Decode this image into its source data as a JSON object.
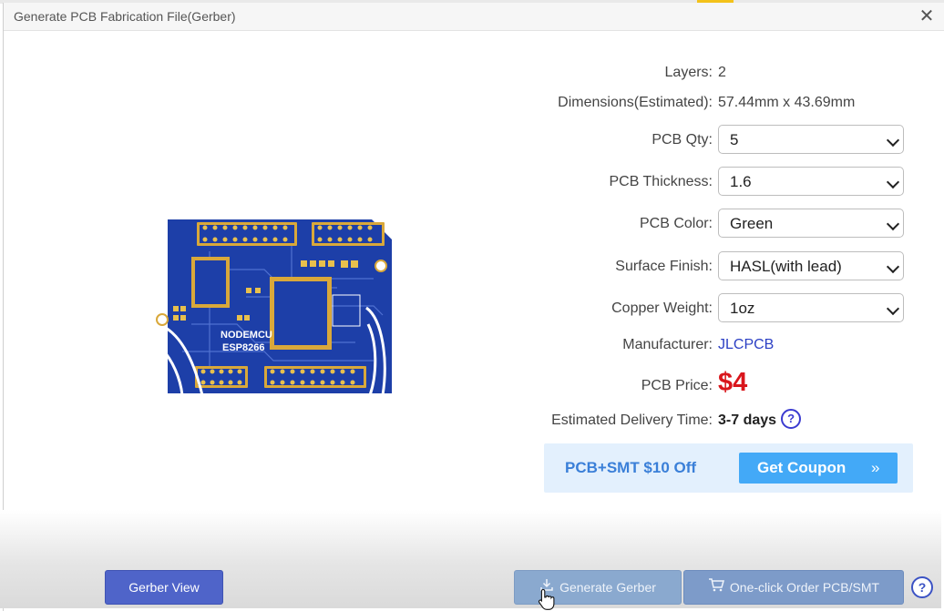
{
  "dialog": {
    "title": "Generate PCB Fabrication File(Gerber)",
    "close_icon": "close-icon"
  },
  "board": {
    "silkscreen_line1": "NODEMCU",
    "silkscreen_line2": "ESP8266"
  },
  "specs": {
    "layers_label": "Layers:",
    "layers_value": "2",
    "dimensions_label": "Dimensions(Estimated):",
    "dimensions_value": "57.44mm x 43.69mm",
    "qty_label": "PCB Qty:",
    "qty_value": "5",
    "thickness_label": "PCB Thickness:",
    "thickness_value": "1.6",
    "color_label": "PCB Color:",
    "color_value": "Green",
    "finish_label": "Surface Finish:",
    "finish_value": "HASL(with lead)",
    "copper_label": "Copper Weight:",
    "copper_value": "1oz",
    "manufacturer_label": "Manufacturer:",
    "manufacturer_value": "JLCPCB",
    "price_label": "PCB Price:",
    "price_value": "$4",
    "delivery_label": "Estimated Delivery Time:",
    "delivery_value": "3-7 days",
    "help_glyph": "?"
  },
  "coupon": {
    "text": "PCB+SMT $10 Off",
    "button_label": "Get Coupon",
    "button_arrow": "»"
  },
  "footer": {
    "gerber_view_label": "Gerber View",
    "generate_label": "Generate Gerber",
    "order_label": "One-click Order PCB/SMT",
    "help_glyph": "?"
  },
  "colors": {
    "price_red": "#d9161c",
    "link_blue": "#2b3fc4",
    "coupon_bg": "#e3f0fd",
    "coupon_button": "#43a9f7",
    "primary_button": "#4f64c9",
    "pcb_blue": "#1d3fa8",
    "pad_gold": "#d9a83a"
  }
}
